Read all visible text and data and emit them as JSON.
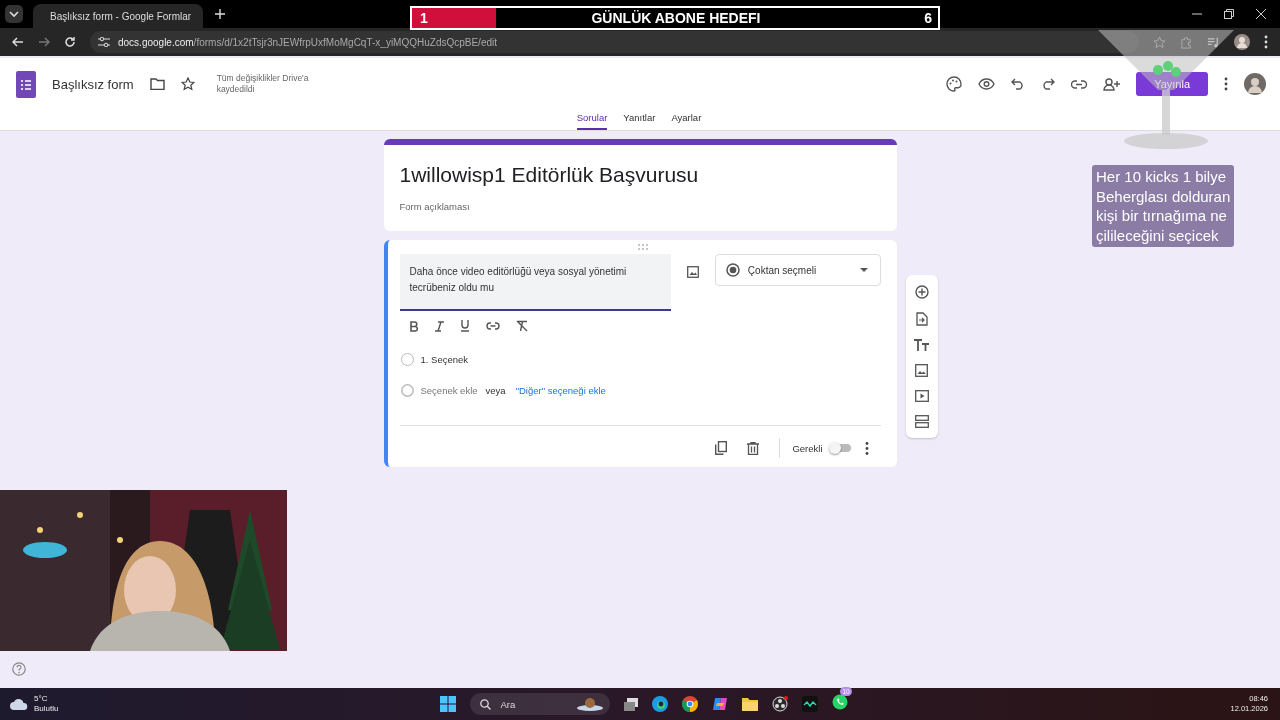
{
  "browser": {
    "tab_title": "Başlıksız form - Google Formlar",
    "url_host": "docs.google.com",
    "url_path": "/forms/d/1x2tTsjr3nJEWfrpUxfMoMgCqT-x_yiMQQHuZdsQcpBE/edit"
  },
  "header": {
    "title": "Başlıksız form",
    "save_status": "Tüm değişiklikler Drive'a kaydedildi",
    "publish_button": "Yayınla"
  },
  "tabs": [
    {
      "label": "Sorular",
      "selected": true
    },
    {
      "label": "Yanıtlar",
      "selected": false
    },
    {
      "label": "Ayarlar",
      "selected": false
    }
  ],
  "form": {
    "title": "1willowisp1 Editörlük Başvurusu",
    "description_placeholder": "Form açıklaması"
  },
  "question": {
    "text": "Daha önce video editörlüğü veya sosyal yönetimi tecrübeniz oldu mu",
    "type": "Çoktan seçmeli",
    "options": [
      {
        "label": "1. Seçenek",
        "selected": false
      }
    ],
    "add_option": "Seçenek ekle",
    "or": "veya",
    "add_other": "\"Diğer\" seçeneği ekle",
    "required_label": "Gerekli",
    "required": false
  },
  "overlay": {
    "goal": {
      "current": "1",
      "label": "GÜNLÜK ABONE HEDEFI",
      "target": "6",
      "level": 0.16
    },
    "note": [
      "Her 10 kicks 1 bilye",
      "Beherglası dolduran",
      "kişi bir tırnağıma ne",
      "çilileceğini seçicek"
    ]
  },
  "taskbar": {
    "weather": {
      "temp": "5°C",
      "condition": "Bulutlu"
    },
    "search": "Ara",
    "whatsapp_badge": "10",
    "time": "08:46",
    "date": "12.01.2026"
  }
}
